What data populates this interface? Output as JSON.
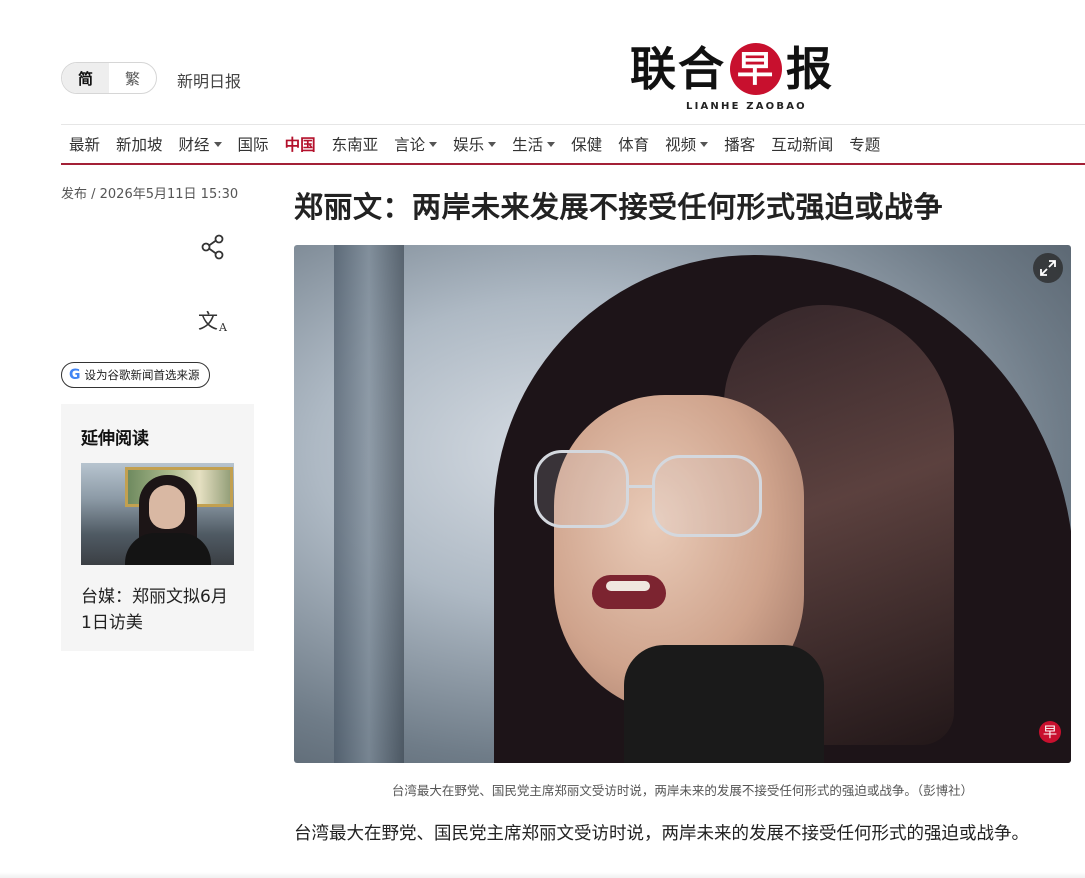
{
  "header": {
    "lang": {
      "simplified": "简",
      "traditional": "繁"
    },
    "sister_site": "新明日报",
    "logo": {
      "cn_1": "联合",
      "cn_zao": "早",
      "cn_2": "报",
      "en": "LIANHE ZAOBAO",
      "brand_color": "#c8102e"
    }
  },
  "nav": {
    "items": [
      {
        "label": "最新",
        "dropdown": false
      },
      {
        "label": "新加坡",
        "dropdown": false
      },
      {
        "label": "财经",
        "dropdown": true
      },
      {
        "label": "国际",
        "dropdown": false
      },
      {
        "label": "中国",
        "dropdown": false,
        "active": true
      },
      {
        "label": "东南亚",
        "dropdown": false
      },
      {
        "label": "言论",
        "dropdown": true
      },
      {
        "label": "娱乐",
        "dropdown": true
      },
      {
        "label": "生活",
        "dropdown": true
      },
      {
        "label": "保健",
        "dropdown": false
      },
      {
        "label": "体育",
        "dropdown": false
      },
      {
        "label": "视频",
        "dropdown": true
      },
      {
        "label": "播客",
        "dropdown": false
      },
      {
        "label": "互动新闻",
        "dropdown": false
      },
      {
        "label": "专题",
        "dropdown": false
      }
    ],
    "active_color": "#b3102b"
  },
  "article": {
    "publish": "发布 / 2026年5月11日 15:30",
    "headline": "郑丽文：两岸未来发展不接受任何形式强迫或战争",
    "caption": "台湾最大在野党、国民党主席郑丽文受访时说，两岸未来的发展不接受任何形式的强迫或战争。（彭博社）",
    "paragraph": "台湾最大在野党、国民党主席郑丽文受访时说，两岸未来的发展不接受任何形式的强迫或战争。",
    "watermark": "早"
  },
  "sidebar": {
    "share_icon": "share-icon",
    "translate_icon": {
      "main": "文",
      "sub": "A"
    },
    "google_pref": {
      "g": "G",
      "label": "设为谷歌新闻首选来源"
    },
    "extended": {
      "title": "延伸阅读",
      "link": "台媒：郑丽文拟6月1日访美"
    }
  }
}
